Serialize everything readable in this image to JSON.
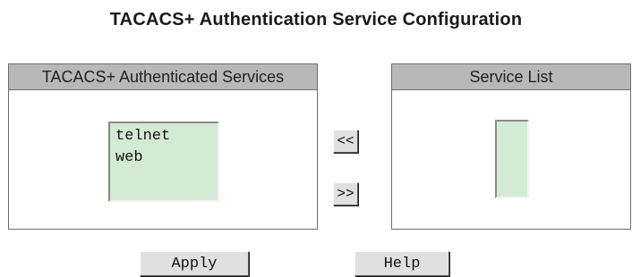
{
  "page": {
    "title": "TACACS+ Authentication Service Configuration"
  },
  "authenticated_panel": {
    "header": "TACACS+ Authenticated Services",
    "items": [
      "telnet",
      "web"
    ]
  },
  "service_list_panel": {
    "header": "Service List",
    "items": []
  },
  "controls": {
    "move_to_authenticated_label": "<<",
    "move_to_service_list_label": ">>",
    "apply_label": "Apply",
    "help_label": "Help"
  },
  "colors": {
    "panel_header_bg": "#b8b8b8",
    "listbox_bg": "#d3ebd3",
    "button_bg": "#e0e0e0"
  }
}
